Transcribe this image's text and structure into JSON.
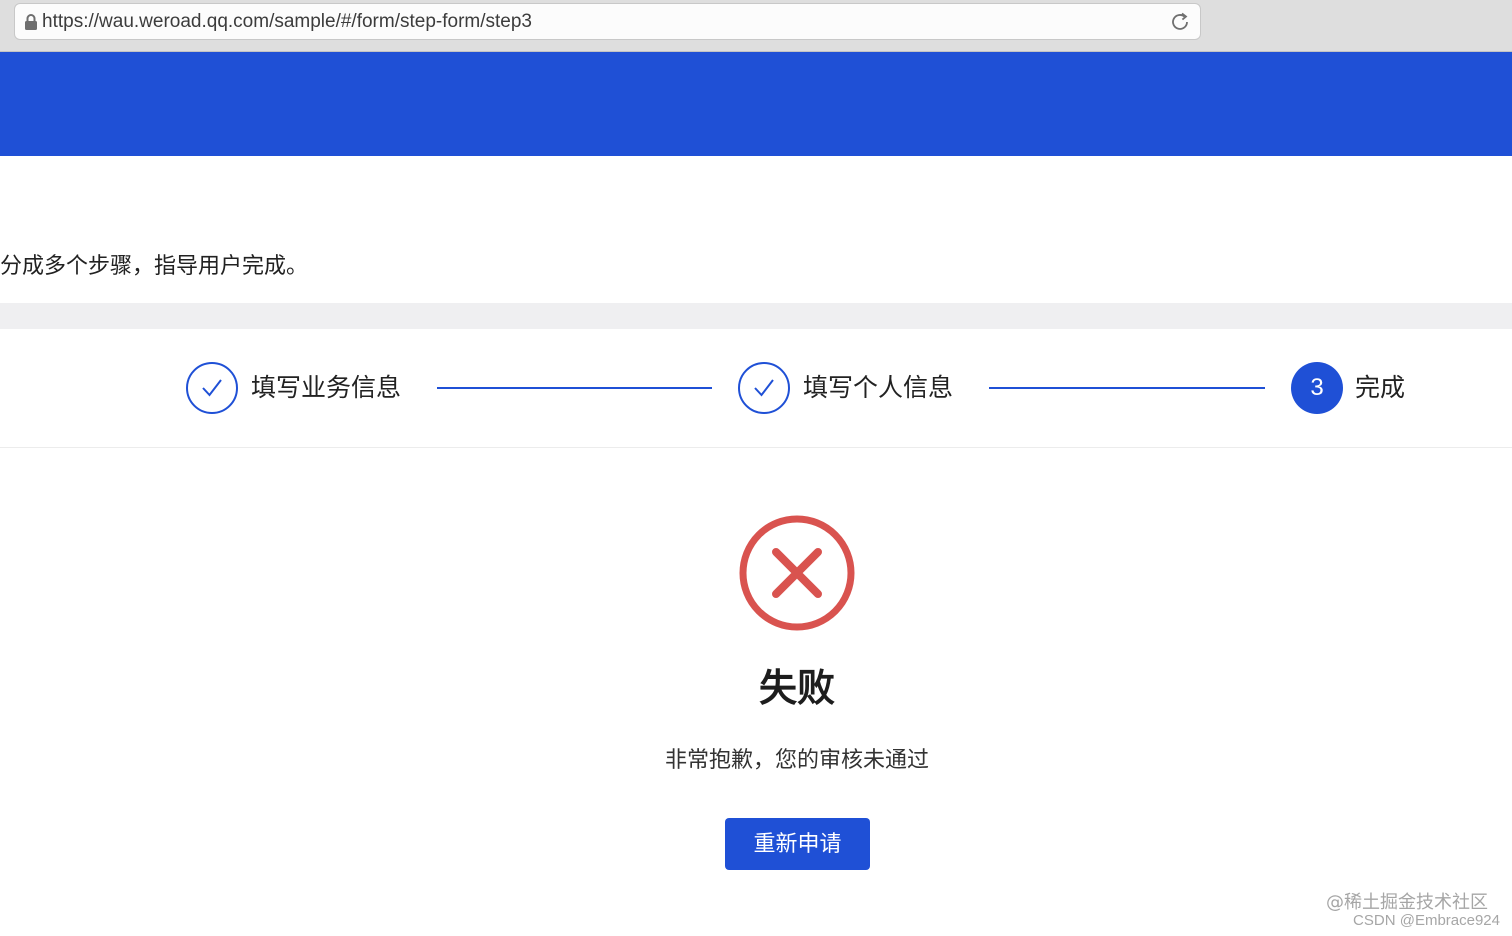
{
  "browser": {
    "url": "https://wau.weroad.qq.com/sample/#/form/step-form/step3"
  },
  "colors": {
    "primary": "#1f50d6",
    "error": "#d9534f",
    "gap": "#efeff1"
  },
  "page": {
    "description": "分成多个步骤，指导用户完成。"
  },
  "steps": [
    {
      "label": "填写业务信息",
      "status": "finished",
      "icon": "check-icon"
    },
    {
      "label": "填写个人信息",
      "status": "finished",
      "icon": "check-icon"
    },
    {
      "number": "3",
      "label": "完成",
      "status": "current"
    }
  ],
  "result": {
    "icon": "error-circle-icon",
    "title": "失败",
    "subtitle": "非常抱歉，您的审核未通过",
    "retry_label": "重新申请"
  },
  "watermark": {
    "line1": "@稀土掘金技术社区",
    "line2": "CSDN @Embrace924"
  }
}
